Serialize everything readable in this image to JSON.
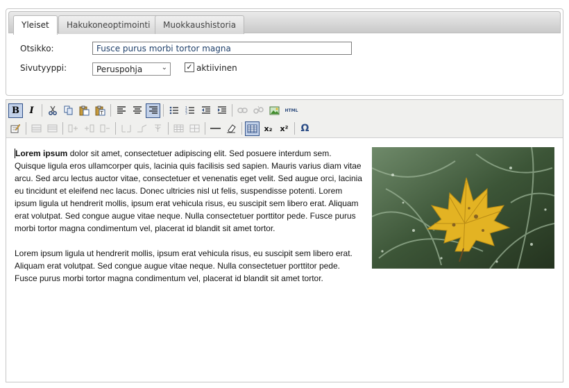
{
  "tabs": [
    {
      "label": "Yleiset",
      "active": true
    },
    {
      "label": "Hakukoneoptimointi",
      "active": false
    },
    {
      "label": "Muokkaushistoria",
      "active": false
    }
  ],
  "form": {
    "title_label": "Otsikko:",
    "title_value": "Fusce purus morbi tortor magna",
    "page_type_label": "Sivutyyppi:",
    "page_type_value": "Peruspohja",
    "active_label": "aktiivinen",
    "active_checked": true
  },
  "toolbar": {
    "row1": [
      "bold",
      "italic",
      "cut",
      "copy",
      "paste",
      "paste-text",
      "paste-word",
      "align-left",
      "align-center",
      "align-right",
      "bullet-list",
      "numbered-list",
      "outdent",
      "indent",
      "link",
      "unlink",
      "image",
      "html"
    ],
    "row2": [
      "cleanup",
      "table-row-before",
      "table-row-after",
      "column-before",
      "column-after",
      "delete-column",
      "split-cells",
      "merge-cells",
      "table-props",
      "cell-props",
      "horizontal-rule",
      "remove-format",
      "visual-aid",
      "subscript",
      "superscript",
      "special-char"
    ],
    "bold_label": "B",
    "italic_label": "I",
    "html_label": "HTML",
    "subscript_label": "x₂",
    "superscript_label": "x²",
    "omega_label": "Ω"
  },
  "content": {
    "p1_bold": "Lorem ipsum",
    "p1_rest": " dolor sit amet, consectetuer adipiscing elit. Sed posuere interdum sem. Quisque ligula eros ullamcorper quis, lacinia quis facilisis sed sapien. Mauris varius diam vitae arcu. Sed arcu lectus auctor vitae, consectetuer et venenatis eget velit. Sed augue orci, lacinia eu tincidunt et eleifend nec lacus. Donec ultricies nisl ut felis, suspendisse potenti. Lorem ipsum ligula ut hendrerit mollis, ipsum erat vehicula risus, eu suscipit sem libero erat. Aliquam erat volutpat. Sed congue augue vitae neque. Nulla consectetuer porttitor pede. Fusce purus morbi tortor magna condimentum vel, placerat id blandit sit amet tortor.",
    "p2": "Lorem ipsum ligula ut hendrerit mollis, ipsum erat vehicula risus, eu suscipit sem libero erat. Aliquam erat volutpat. Sed congue augue vitae neque. Nulla consectetuer porttitor pede. Fusce purus morbi tortor magna condimentum vel, placerat id blandit sit amet tortor."
  },
  "colors": {
    "accent": "#2e4f88",
    "leaf": "#e3b323",
    "toolbar_bg": "#f0f0ee"
  }
}
